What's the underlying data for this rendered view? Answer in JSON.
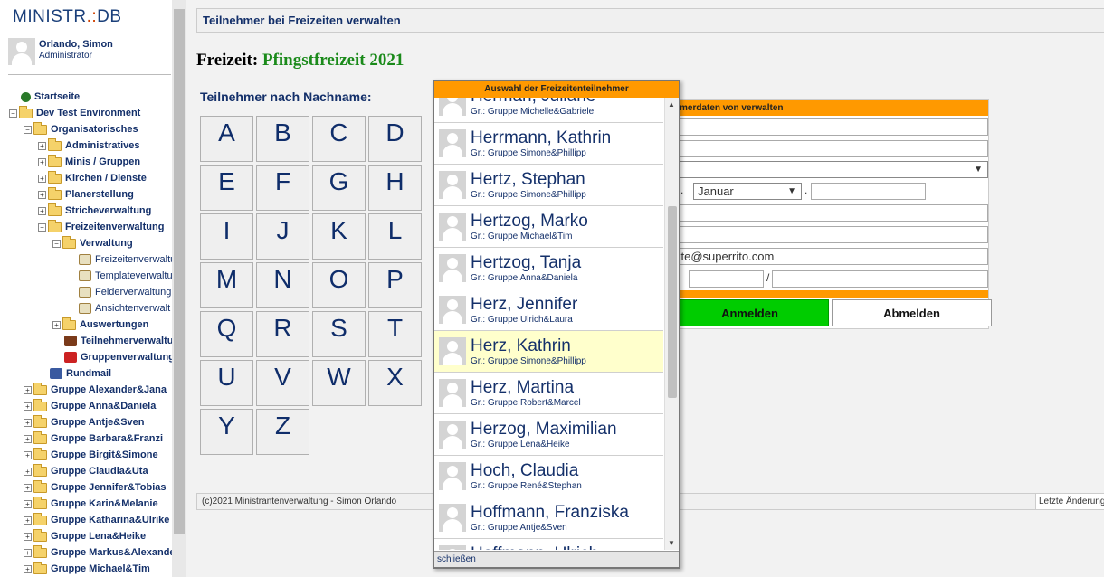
{
  "app": {
    "logo_main": "MINISTR",
    "logo_sep": ".:",
    "logo_end": "DB"
  },
  "user": {
    "name": "Orlando, Simon",
    "role": "Administrator"
  },
  "tree": [
    {
      "label": "Startseite",
      "icon": "globe-icon",
      "level": 0,
      "toggle": ""
    },
    {
      "label": "Dev Test Environment",
      "icon": "folder-icon",
      "level": 0,
      "toggle": "-"
    },
    {
      "label": "Organisatorisches",
      "icon": "folder-icon",
      "level": 1,
      "toggle": "-"
    },
    {
      "label": "Administratives",
      "icon": "folder-icon",
      "level": 2,
      "toggle": "+"
    },
    {
      "label": "Minis / Gruppen",
      "icon": "folder-icon",
      "level": 2,
      "toggle": "+"
    },
    {
      "label": "Kirchen / Dienste",
      "icon": "folder-icon",
      "level": 2,
      "toggle": "+"
    },
    {
      "label": "Planerstellung",
      "icon": "folder-icon",
      "level": 2,
      "toggle": "+"
    },
    {
      "label": "Stricheverwaltung",
      "icon": "folder-icon",
      "level": 2,
      "toggle": "+"
    },
    {
      "label": "Freizeitenverwaltung",
      "icon": "folder-icon",
      "level": 2,
      "toggle": "-"
    },
    {
      "label": "Verwaltung",
      "icon": "folder-icon",
      "level": 3,
      "toggle": "-"
    },
    {
      "label": "Freizeitenverwaltu",
      "icon": "page-icon",
      "level": 4,
      "toggle": ""
    },
    {
      "label": "Templateverwaltu",
      "icon": "page-icon",
      "level": 4,
      "toggle": ""
    },
    {
      "label": "Felderverwaltung",
      "icon": "page-icon",
      "level": 4,
      "toggle": ""
    },
    {
      "label": "Ansichtenverwalt",
      "icon": "page-icon",
      "level": 4,
      "toggle": ""
    },
    {
      "label": "Auswertungen",
      "icon": "folder-icon",
      "level": 3,
      "toggle": "+"
    },
    {
      "label": "Teilnehmerverwaltung",
      "icon": "people-icon",
      "level": 3,
      "toggle": ""
    },
    {
      "label": "Gruppenverwaltung",
      "icon": "group-icon",
      "level": 3,
      "toggle": ""
    },
    {
      "label": "Rundmail",
      "icon": "mail-icon",
      "level": 2,
      "toggle": ""
    },
    {
      "label": "Gruppe Alexander&Jana",
      "icon": "folder-icon",
      "level": 1,
      "toggle": "+"
    },
    {
      "label": "Gruppe Anna&Daniela",
      "icon": "folder-icon",
      "level": 1,
      "toggle": "+"
    },
    {
      "label": "Gruppe Antje&Sven",
      "icon": "folder-icon",
      "level": 1,
      "toggle": "+"
    },
    {
      "label": "Gruppe Barbara&Franzi",
      "icon": "folder-icon",
      "level": 1,
      "toggle": "+"
    },
    {
      "label": "Gruppe Birgit&Simone",
      "icon": "folder-icon",
      "level": 1,
      "toggle": "+"
    },
    {
      "label": "Gruppe Claudia&Uta",
      "icon": "folder-icon",
      "level": 1,
      "toggle": "+"
    },
    {
      "label": "Gruppe Jennifer&Tobias",
      "icon": "folder-icon",
      "level": 1,
      "toggle": "+"
    },
    {
      "label": "Gruppe Karin&Melanie",
      "icon": "folder-icon",
      "level": 1,
      "toggle": "+"
    },
    {
      "label": "Gruppe Katharina&Ulrike",
      "icon": "folder-icon",
      "level": 1,
      "toggle": "+"
    },
    {
      "label": "Gruppe Lena&Heike",
      "icon": "folder-icon",
      "level": 1,
      "toggle": "+"
    },
    {
      "label": "Gruppe Markus&Alexander",
      "icon": "folder-icon",
      "level": 1,
      "toggle": "+"
    },
    {
      "label": "Gruppe Michael&Tim",
      "icon": "folder-icon",
      "level": 1,
      "toggle": "+"
    }
  ],
  "header": {
    "title": "Teilnehmer bei Freizeiten verwalten"
  },
  "freizeit": {
    "label": "Freizeit:",
    "name": "Pfingstfreizeit 2021"
  },
  "letters_label": "Teilnehmer nach Nachname:",
  "letters": [
    "A",
    "B",
    "C",
    "D",
    "E",
    "F",
    "G",
    "H",
    "I",
    "J",
    "K",
    "L",
    "M",
    "N",
    "O",
    "P",
    "Q",
    "R",
    "S",
    "T",
    "U",
    "V",
    "W",
    "X",
    "Y",
    "Z"
  ],
  "form": {
    "header": "merdaten von verwalten",
    "month": "Januar",
    "email": "ste@superrito.com",
    "slash": "/",
    "dot1": ".",
    "dot2": ".",
    "btn_anmelden": "Anmelden",
    "btn_abmelden": "Abmelden"
  },
  "popup": {
    "title": "Auswahl der Freizeitenteilnehmer",
    "close": "schließen",
    "items": [
      {
        "name": "Herman, Juliane",
        "group": "Gr.: Gruppe Michelle&Gabriele",
        "highlight": false
      },
      {
        "name": "Herrmann, Kathrin",
        "group": "Gr.: Gruppe Simone&Phillipp",
        "highlight": false
      },
      {
        "name": "Hertz, Stephan",
        "group": "Gr.: Gruppe Simone&Phillipp",
        "highlight": false
      },
      {
        "name": "Hertzog, Marko",
        "group": "Gr.: Gruppe Michael&Tim",
        "highlight": false
      },
      {
        "name": "Hertzog, Tanja",
        "group": "Gr.: Gruppe Anna&Daniela",
        "highlight": false
      },
      {
        "name": "Herz, Jennifer",
        "group": "Gr.: Gruppe Ulrich&Laura",
        "highlight": false
      },
      {
        "name": "Herz, Kathrin",
        "group": "Gr.: Gruppe Simone&Phillipp",
        "highlight": true
      },
      {
        "name": "Herz, Martina",
        "group": "Gr.: Gruppe Robert&Marcel",
        "highlight": false
      },
      {
        "name": "Herzog, Maximilian",
        "group": "Gr.: Gruppe Lena&Heike",
        "highlight": false
      },
      {
        "name": "Hoch, Claudia",
        "group": "Gr.: Gruppe René&Stephan",
        "highlight": false
      },
      {
        "name": "Hoffmann, Franziska",
        "group": "Gr.: Gruppe Antje&Sven",
        "highlight": false
      },
      {
        "name": "Hoffmann, Ulrich",
        "group": "",
        "highlight": false
      }
    ]
  },
  "footer": {
    "text": "(c)2021 Ministrantenverwaltung - Simon Orlando",
    "right": "Letzte Änderung"
  }
}
